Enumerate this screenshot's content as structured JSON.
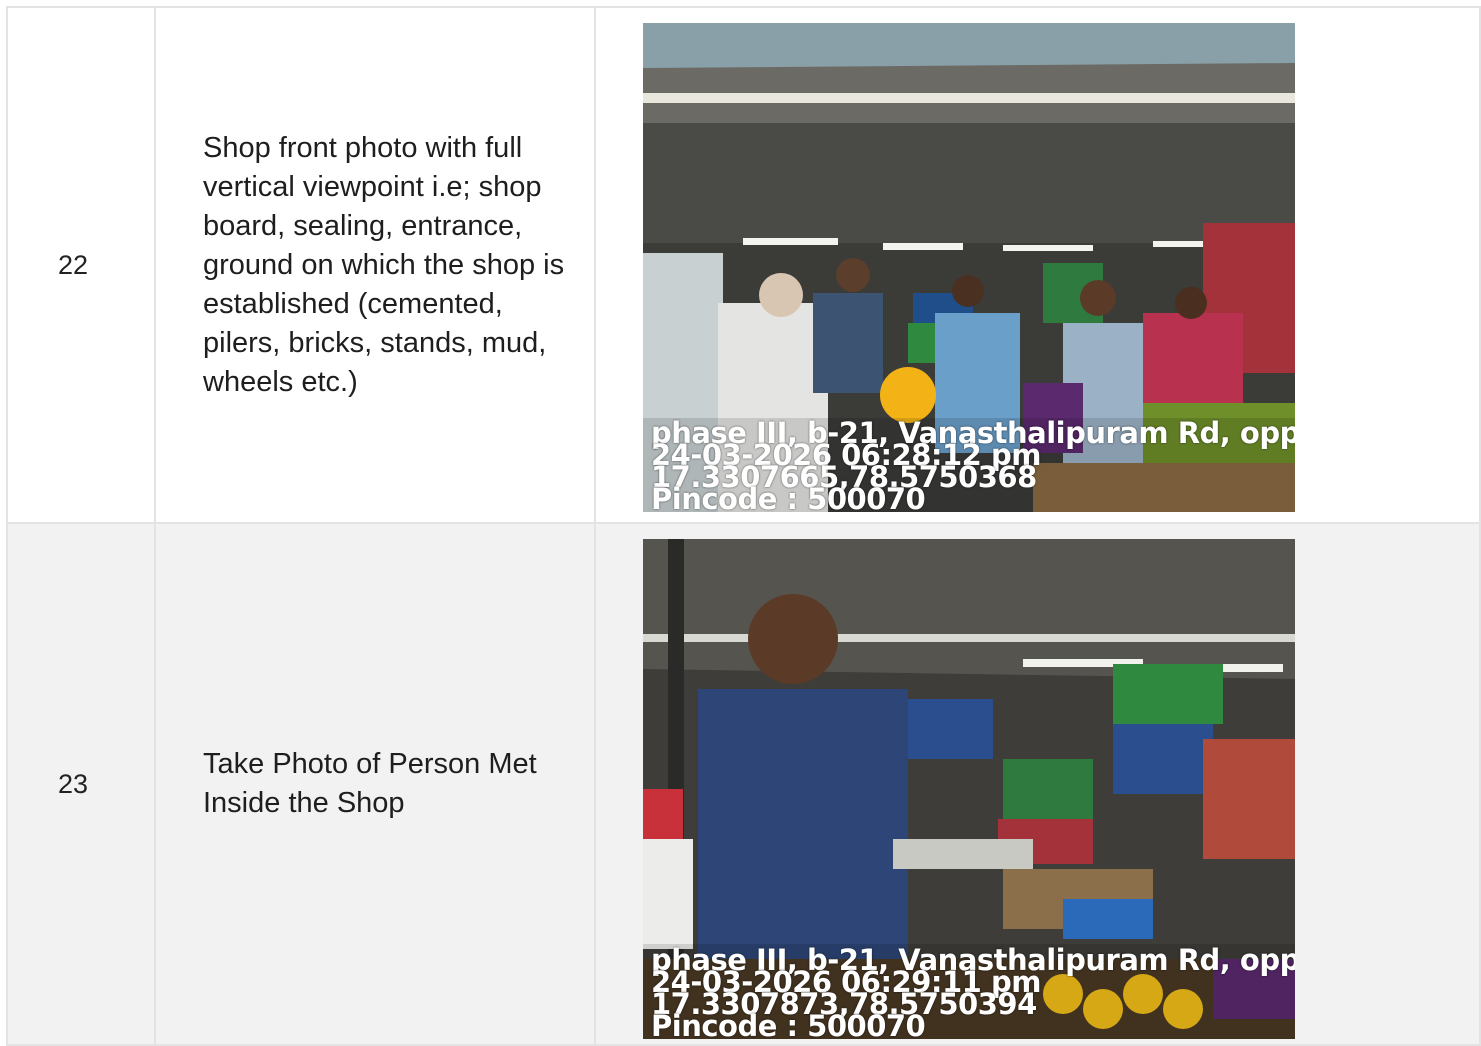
{
  "rows": [
    {
      "number": "22",
      "description": "Shop front photo with full vertical viewpoint i.e; shop board, sealing, entrance, ground on which the shop is established (cemented, pilers, bricks, stands, mud, wheels etc.)",
      "photo": {
        "address": "phase III, b-21, Vanasthalipuram Rd, opp. ...",
        "datetime": "24-03-2026 06:28:12 pm",
        "coordinates": "17.3307665,78.5750368",
        "pincode": "Pincode : 500070"
      }
    },
    {
      "number": "23",
      "description": "Take Photo of Person Met Inside the Shop",
      "photo": {
        "address": "phase III, b-21, Vanasthalipuram Rd, opp. ...",
        "datetime": "24-03-2026 06:29:11 pm",
        "coordinates": "17.3307873,78.5750394",
        "pincode": "Pincode : 500070"
      }
    }
  ]
}
